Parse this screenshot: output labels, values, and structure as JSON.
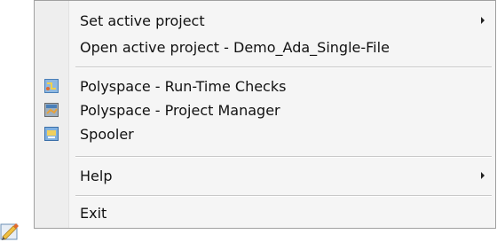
{
  "menu": {
    "items": [
      {
        "label": "Set active project",
        "submenu": true,
        "icon": null
      },
      {
        "label": "Open active project - Demo_Ada_Single-File",
        "submenu": false,
        "icon": null
      },
      {
        "label": "Polyspace - Run-Time Checks",
        "submenu": false,
        "icon": "polyspace-rtc-icon"
      },
      {
        "label": "Polyspace - Project Manager",
        "submenu": false,
        "icon": "polyspace-pm-icon"
      },
      {
        "label": "Spooler",
        "submenu": false,
        "icon": "spooler-icon"
      },
      {
        "label": "Help",
        "submenu": true,
        "icon": null
      },
      {
        "label": "Exit",
        "submenu": false,
        "icon": null
      }
    ]
  },
  "tray": {
    "icon": "polyspace-tray-icon"
  }
}
